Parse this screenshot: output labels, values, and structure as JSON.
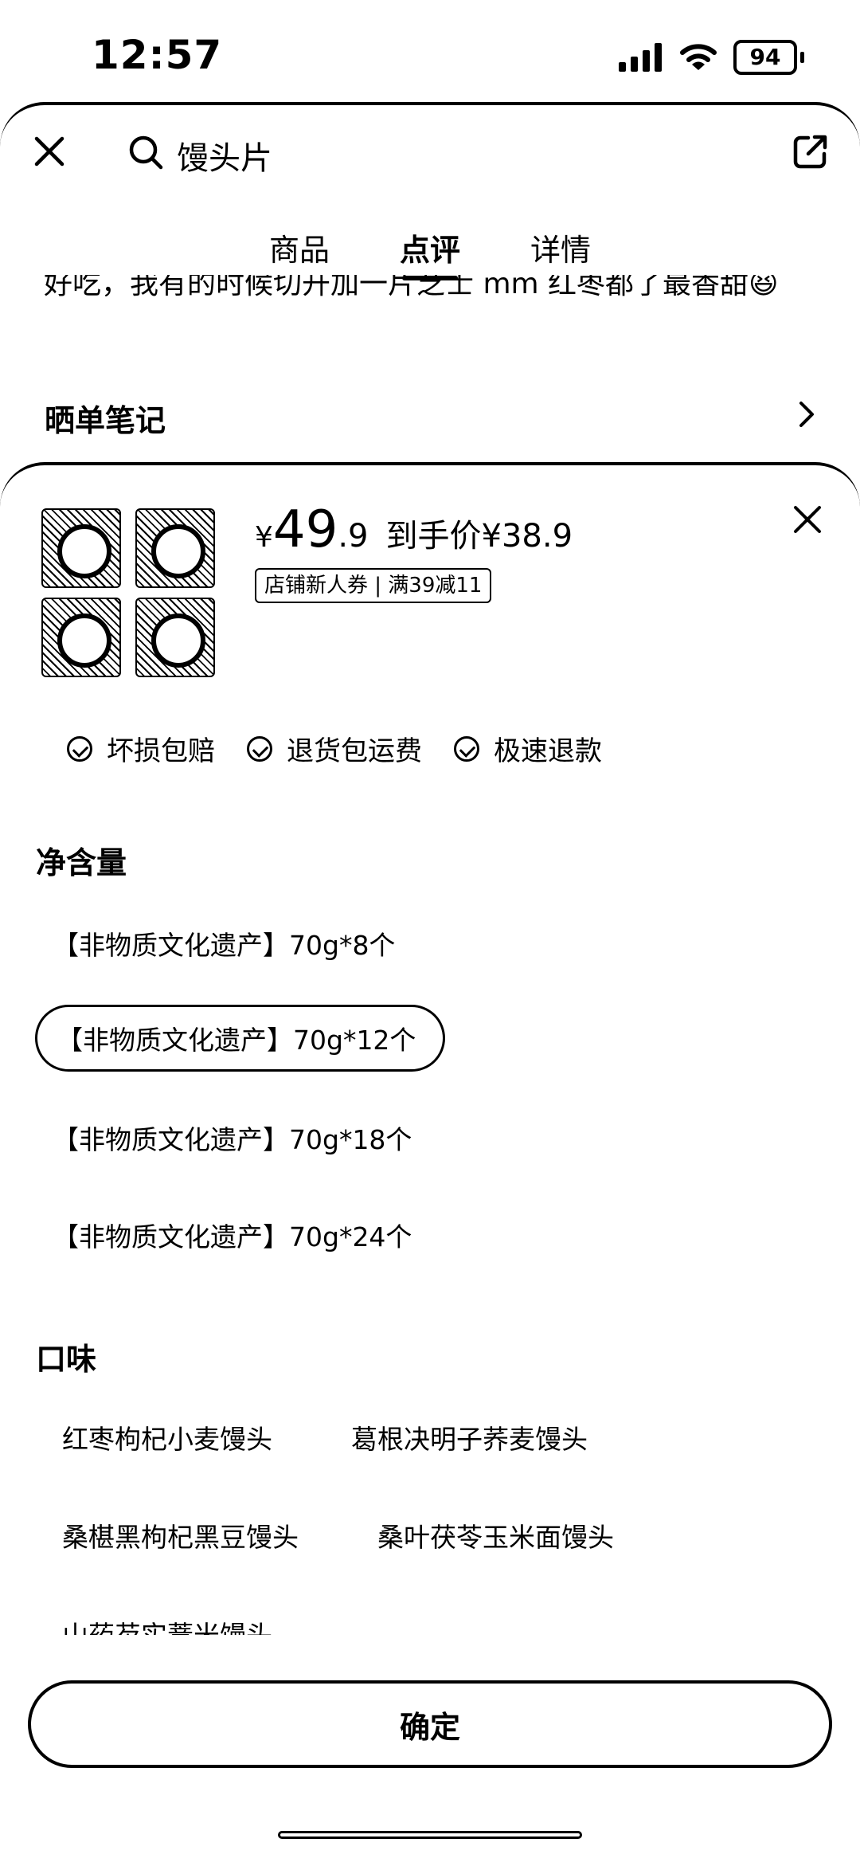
{
  "status_bar": {
    "time": "12:57",
    "battery": "94"
  },
  "header": {
    "search_text": "馒头片",
    "tabs": [
      {
        "label": "商品",
        "active": false
      },
      {
        "label": "点评",
        "active": true
      },
      {
        "label": "详情",
        "active": false
      }
    ]
  },
  "background": {
    "review_snippet": "好吃，我有的时候切开加一片芝士 mm 红枣都了最香甜😆",
    "notes_title": "晒单笔记"
  },
  "sheet": {
    "price_symbol": "¥",
    "price_integer": "49",
    "price_decimal": ".9",
    "final_price": "到手价¥38.9",
    "coupon": "店铺新人券 | 满39减11",
    "guarantees": [
      "坏损包赔",
      "退货包运费",
      "极速退款"
    ],
    "net_content": {
      "title": "净含量",
      "options": [
        "【非物质文化遗产】70g*8个",
        "【非物质文化遗产】70g*12个",
        "【非物质文化遗产】70g*18个",
        "【非物质文化遗产】70g*24个"
      ],
      "selected": "【非物质文化遗产】70g*12个"
    },
    "flavor": {
      "title": "口味",
      "options": [
        "红枣枸杞小麦馒头",
        "葛根决明子荞麦馒头",
        "桑椹黑枸杞黑豆馒头",
        "桑叶茯苓玉米面馒头",
        "山药芡实薏米馒头"
      ]
    },
    "confirm_label": "确定"
  }
}
